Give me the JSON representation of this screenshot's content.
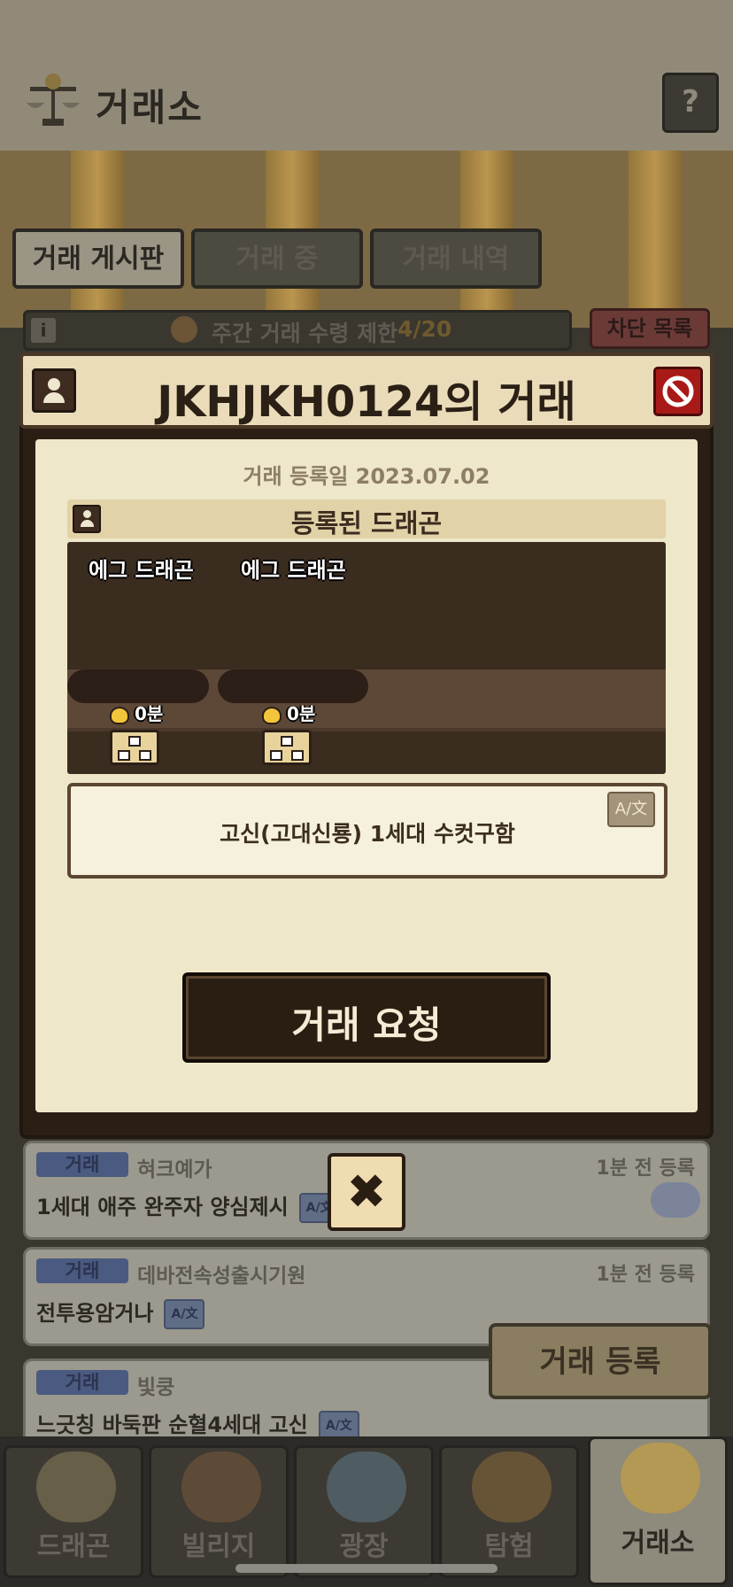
{
  "header": {
    "title": "거래소",
    "help_label": "?",
    "tabs": [
      {
        "label": "거래 게시판",
        "active": true
      },
      {
        "label": "거래 중",
        "active": false
      },
      {
        "label": "거래 내역",
        "active": false
      }
    ],
    "weekly_limit_label": "주간 거래 수령 제한",
    "weekly_limit_value": "4/20",
    "info_icon_label": "i",
    "block_list_label": "차단 목록"
  },
  "modal": {
    "title": "JKHJKH0124의 거래",
    "registered_date_label": "거래 등록일 2023.07.02",
    "section_title": "등록된 드래곤",
    "dragons": [
      {
        "name": "에그 드래곤",
        "life": "0분"
      },
      {
        "name": "에그 드래곤",
        "life": "0분"
      }
    ],
    "message": "고신(고대신룡) 1세대 수컷구함",
    "translate_label": "A/文",
    "request_button": "거래 요청",
    "close_label": "✖"
  },
  "list": {
    "items": [
      {
        "tag": "거래",
        "user": "혀크예가",
        "time": "1분 전 등록",
        "message": "1세대 애주 완주자 양심제시"
      },
      {
        "tag": "거래",
        "user": "데바전속성출시기원",
        "time": "1분 전 등록",
        "message": "전투용암거나"
      },
      {
        "tag": "거래",
        "user": "빛쿵",
        "time": "",
        "message": "느긋칭 바둑판 순혈4세대 고신"
      }
    ],
    "translate_mini": "A/文",
    "register_button": "거래 등록"
  },
  "nav": {
    "items": [
      {
        "label": "드래곤",
        "active": false
      },
      {
        "label": "빌리지",
        "active": false
      },
      {
        "label": "광장",
        "active": false
      },
      {
        "label": "탐험",
        "active": false
      },
      {
        "label": "거래소",
        "active": true
      }
    ]
  },
  "colors": {
    "modal_body": "#efe7c9",
    "modal_frame": "#2b1f15",
    "ban_red": "#a81a17",
    "heart_gold": "#f3c53b"
  }
}
